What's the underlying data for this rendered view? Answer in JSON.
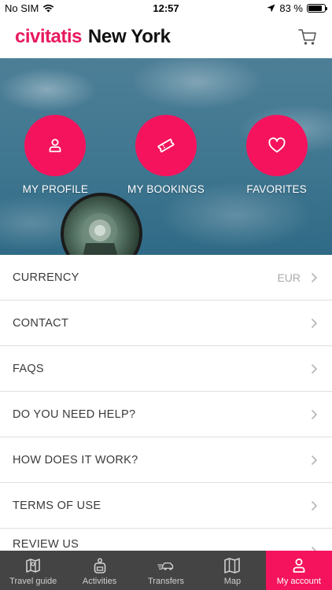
{
  "status_bar": {
    "carrier": "No SIM",
    "time": "12:57",
    "battery_percent": "83 %",
    "battery_level": 0.83
  },
  "header": {
    "brand": "civitatis",
    "city": "New York",
    "cart_icon": "cart-icon"
  },
  "hero": {
    "shortcuts": [
      {
        "label": "MY PROFILE",
        "icon": "user-icon"
      },
      {
        "label": "MY BOOKINGS",
        "icon": "ticket-icon"
      },
      {
        "label": "FAVORITES",
        "icon": "heart-icon"
      }
    ]
  },
  "menu": {
    "items": [
      {
        "label": "CURRENCY",
        "value": "EUR"
      },
      {
        "label": "CONTACT"
      },
      {
        "label": "FAQS"
      },
      {
        "label": "DO YOU NEED HELP?"
      },
      {
        "label": "HOW DOES IT WORK?"
      },
      {
        "label": "TERMS OF USE"
      },
      {
        "label": "REVIEW US"
      }
    ]
  },
  "tab_bar": {
    "tabs": [
      {
        "label": "Travel guide",
        "icon": "map-book-icon"
      },
      {
        "label": "Activities",
        "icon": "backpack-icon"
      },
      {
        "label": "Transfers",
        "icon": "car-icon"
      },
      {
        "label": "Map",
        "icon": "map-icon"
      },
      {
        "label": "My account",
        "icon": "user-icon",
        "active": true
      }
    ]
  },
  "colors": {
    "brand": "#f5135d",
    "tab_bar_bg": "#444444"
  }
}
